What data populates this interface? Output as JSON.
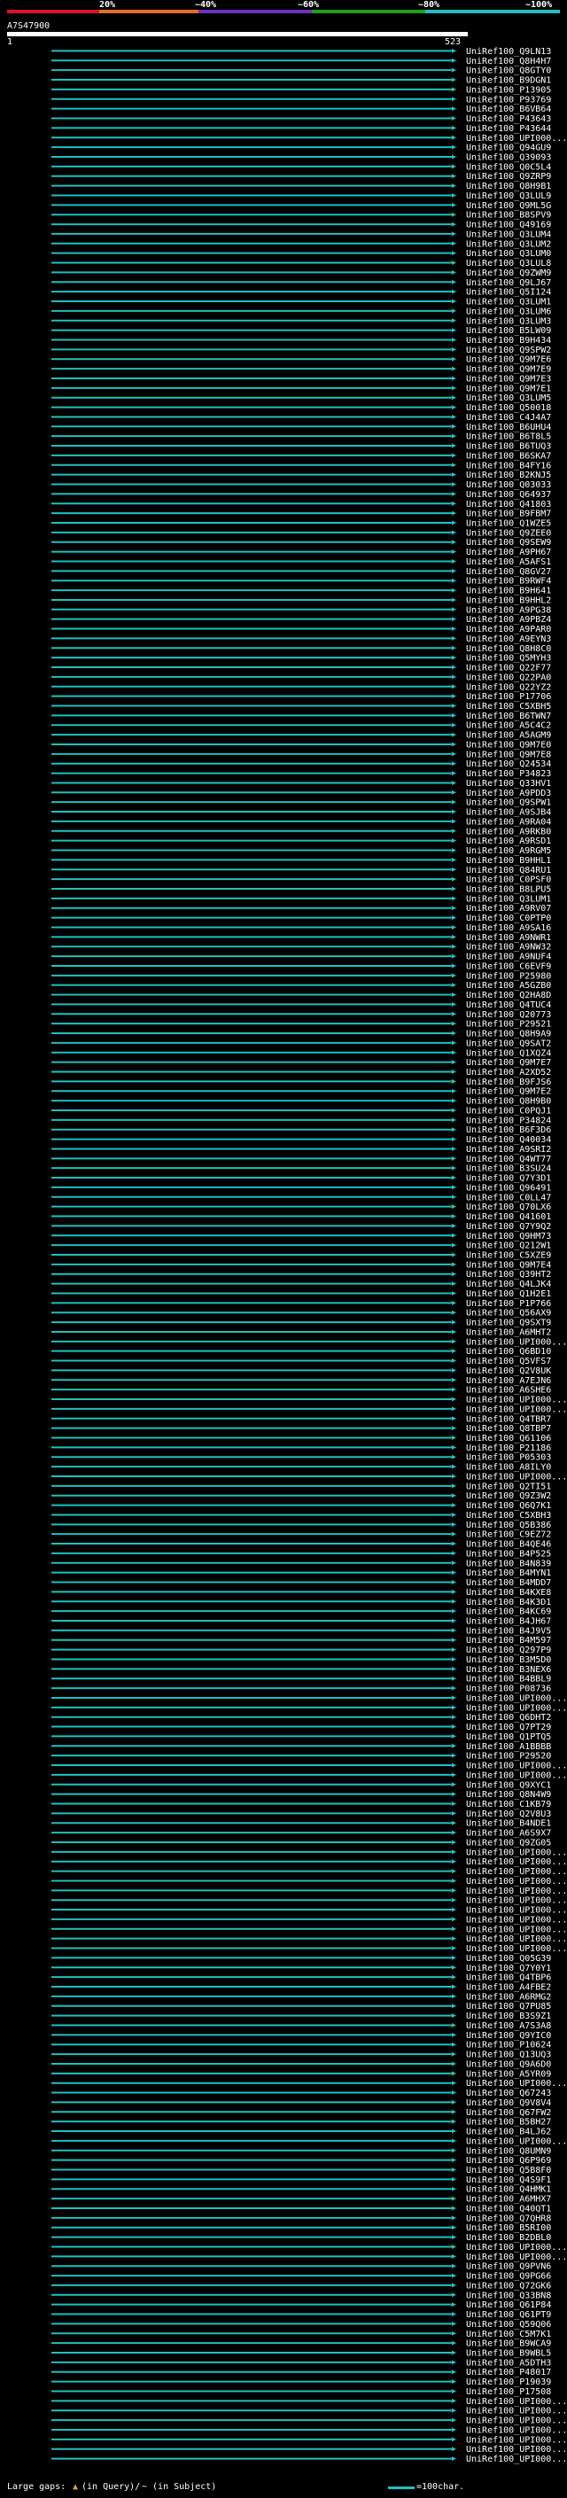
{
  "header": {
    "tick_labels": [
      "20%",
      "~40%",
      "~60%",
      "~80%",
      "~100%"
    ],
    "tick_colors": [
      "#e0102a",
      "#e07020",
      "#7030c0",
      "#20a020",
      "#20c0c0"
    ]
  },
  "query": {
    "name": "A7S47900",
    "start": "1",
    "end": "523"
  },
  "colors": {
    "hit": "#20c0c0",
    "query_bar": "#ffffff",
    "background": "#000000"
  },
  "hits": [
    {
      "name": "UniRef100_Q9LN13"
    },
    {
      "name": "UniRef100_Q8H4H7"
    },
    {
      "name": "UniRef100_Q8GTY0"
    },
    {
      "name": "UniRef100_B9DGN1"
    },
    {
      "name": "UniRef100_P13905"
    },
    {
      "name": "UniRef100_P93769"
    },
    {
      "name": "UniRef100_B6VB64"
    },
    {
      "name": "UniRef100_P43643"
    },
    {
      "name": "UniRef100_P43644"
    },
    {
      "name": "UniRef100_UPI000..."
    },
    {
      "name": "UniRef100_Q94GU9"
    },
    {
      "name": "UniRef100_Q39093"
    },
    {
      "name": "UniRef100_Q0C5L4"
    },
    {
      "name": "UniRef100_Q9ZRP9"
    },
    {
      "name": "UniRef100_Q8H9B1"
    },
    {
      "name": "UniRef100_Q3LUL9"
    },
    {
      "name": "UniRef100_Q9ML5G"
    },
    {
      "name": "UniRef100_B8SPV9"
    },
    {
      "name": "UniRef100_Q49169"
    },
    {
      "name": "UniRef100_Q3LUM4"
    },
    {
      "name": "UniRef100_Q3LUM2"
    },
    {
      "name": "UniRef100_Q3LUM0"
    },
    {
      "name": "UniRef100_Q3LUL8"
    },
    {
      "name": "UniRef100_Q9ZWM9"
    },
    {
      "name": "UniRef100_Q9LJ67"
    },
    {
      "name": "UniRef100_Q5I124"
    },
    {
      "name": "UniRef100_Q3LUM1"
    },
    {
      "name": "UniRef100_Q3LUM6"
    },
    {
      "name": "UniRef100_Q3LUM3"
    },
    {
      "name": "UniRef100_B5LW09"
    },
    {
      "name": "UniRef100_B9H434"
    },
    {
      "name": "UniRef100_Q9SPW2"
    },
    {
      "name": "UniRef100_Q9M7E6"
    },
    {
      "name": "UniRef100_Q9M7E9"
    },
    {
      "name": "UniRef100_Q9M7E3"
    },
    {
      "name": "UniRef100_Q9M7E1"
    },
    {
      "name": "UniRef100_Q3LUM5"
    },
    {
      "name": "UniRef100_Q50018"
    },
    {
      "name": "UniRef100_C4J4A7"
    },
    {
      "name": "UniRef100_B6UHU4"
    },
    {
      "name": "UniRef100_B6T8L5"
    },
    {
      "name": "UniRef100_B6TUQ3"
    },
    {
      "name": "UniRef100_B6SKA7"
    },
    {
      "name": "UniRef100_B4FY16"
    },
    {
      "name": "UniRef100_B2KNJ5"
    },
    {
      "name": "UniRef100_Q03033"
    },
    {
      "name": "UniRef100_Q64937"
    },
    {
      "name": "UniRef100_Q41803"
    },
    {
      "name": "UniRef100_B9FBM7"
    },
    {
      "name": "UniRef100_Q1WZE5"
    },
    {
      "name": "UniRef100_Q9ZEE0"
    },
    {
      "name": "UniRef100_Q9SEW9"
    },
    {
      "name": "UniRef100_A9PH67"
    },
    {
      "name": "UniRef100_A5AFS1"
    },
    {
      "name": "UniRef100_Q8GV27"
    },
    {
      "name": "UniRef100_B9RWF4"
    },
    {
      "name": "UniRef100_B9H641"
    },
    {
      "name": "UniRef100_B9HHL2"
    },
    {
      "name": "UniRef100_A9PG38"
    },
    {
      "name": "UniRef100_A9PBZ4"
    },
    {
      "name": "UniRef100_A9PAR0"
    },
    {
      "name": "UniRef100_A9EYN3"
    },
    {
      "name": "UniRef100_Q8H8C0"
    },
    {
      "name": "UniRef100_Q5MYH3"
    },
    {
      "name": "UniRef100_Q22F77"
    },
    {
      "name": "UniRef100_Q22PA0"
    },
    {
      "name": "UniRef100_Q22YZ2"
    },
    {
      "name": "UniRef100_P17706"
    },
    {
      "name": "UniRef100_C5XBH5"
    },
    {
      "name": "UniRef100_B6TWN7"
    },
    {
      "name": "UniRef100_A5C4C2"
    },
    {
      "name": "UniRef100_A5AGM9"
    },
    {
      "name": "UniRef100_Q9M7E0"
    },
    {
      "name": "UniRef100_Q9M7E8"
    },
    {
      "name": "UniRef100_Q24534"
    },
    {
      "name": "UniRef100_P34823"
    },
    {
      "name": "UniRef100_Q33HV1"
    },
    {
      "name": "UniRef100_A9PDD3"
    },
    {
      "name": "UniRef100_Q9SPW1"
    },
    {
      "name": "UniRef100_A9SJB4"
    },
    {
      "name": "UniRef100_A9RA04"
    },
    {
      "name": "UniRef100_A9RKB0"
    },
    {
      "name": "UniRef100_A9RSD1"
    },
    {
      "name": "UniRef100_A9RGM5"
    },
    {
      "name": "UniRef100_B9HHL1"
    },
    {
      "name": "UniRef100_Q84RU1"
    },
    {
      "name": "UniRef100_C0PSF0"
    },
    {
      "name": "UniRef100_B8LPU5"
    },
    {
      "name": "UniRef100_Q3LUM1"
    },
    {
      "name": "UniRef100_A9RV07"
    },
    {
      "name": "UniRef100_C0PTP0"
    },
    {
      "name": "UniRef100_A9SA16"
    },
    {
      "name": "UniRef100_A9NWR1"
    },
    {
      "name": "UniRef100_A9NW32"
    },
    {
      "name": "UniRef100_A9NUF4"
    },
    {
      "name": "UniRef100_C6EVF9"
    },
    {
      "name": "UniRef100_P25980"
    },
    {
      "name": "UniRef100_A5GZB0"
    },
    {
      "name": "UniRef100_Q2HA8D"
    },
    {
      "name": "UniRef100_Q4TUC4"
    },
    {
      "name": "UniRef100_Q20773"
    },
    {
      "name": "UniRef100_P29521"
    },
    {
      "name": "UniRef100_Q8H9A9"
    },
    {
      "name": "UniRef100_Q9SAT2"
    },
    {
      "name": "UniRef100_Q1XQZ4"
    },
    {
      "name": "UniRef100_Q9M7E7"
    },
    {
      "name": "UniRef100_A2XD52"
    },
    {
      "name": "UniRef100_B9FJS6"
    },
    {
      "name": "UniRef100_Q9M7E2"
    },
    {
      "name": "UniRef100_Q8H9B0"
    },
    {
      "name": "UniRef100_C0PQJ1"
    },
    {
      "name": "UniRef100_P34824"
    },
    {
      "name": "UniRef100_B6F3D6"
    },
    {
      "name": "UniRef100_Q40034"
    },
    {
      "name": "UniRef100_A9SRI2"
    },
    {
      "name": "UniRef100_Q4WT77"
    },
    {
      "name": "UniRef100_B3SU24"
    },
    {
      "name": "UniRef100_Q7Y3D1"
    },
    {
      "name": "UniRef100_Q96491"
    },
    {
      "name": "UniRef100_C0LL47"
    },
    {
      "name": "UniRef100_Q70LX6"
    },
    {
      "name": "UniRef100_Q41601"
    },
    {
      "name": "UniRef100_Q7Y9Q2"
    },
    {
      "name": "UniRef100_Q9HM73"
    },
    {
      "name": "UniRef100_Q212W1"
    },
    {
      "name": "UniRef100_C5XZE9"
    },
    {
      "name": "UniRef100_Q9M7E4"
    },
    {
      "name": "UniRef100_Q39HT2"
    },
    {
      "name": "UniRef100_Q4LJK4"
    },
    {
      "name": "UniRef100_Q1H2E1"
    },
    {
      "name": "UniRef100_P1P766"
    },
    {
      "name": "UniRef100_Q56AX9"
    },
    {
      "name": "UniRef100_Q9SXT9"
    },
    {
      "name": "UniRef100_A6MHT2"
    },
    {
      "name": "UniRef100_UPI000..."
    },
    {
      "name": "UniRef100_Q6BD10"
    },
    {
      "name": "UniRef100_Q5VFS7"
    },
    {
      "name": "UniRef100_Q2V8UK"
    },
    {
      "name": "UniRef100_A7EJN6"
    },
    {
      "name": "UniRef100_A6SHE6"
    },
    {
      "name": "UniRef100_UPI000..."
    },
    {
      "name": "UniRef100_UPI000..."
    },
    {
      "name": "UniRef100_Q4TBR7"
    },
    {
      "name": "UniRef100_Q8TBP7"
    },
    {
      "name": "UniRef100_Q61106"
    },
    {
      "name": "UniRef100_P21186"
    },
    {
      "name": "UniRef100_P05303"
    },
    {
      "name": "UniRef100_A8ILY0"
    },
    {
      "name": "UniRef100_UPI000..."
    },
    {
      "name": "UniRef100_Q2TI51"
    },
    {
      "name": "UniRef100_Q9Z3W2"
    },
    {
      "name": "UniRef100_Q6Q7K1"
    },
    {
      "name": "UniRef100_C5XBH3"
    },
    {
      "name": "UniRef100_Q5B386"
    },
    {
      "name": "UniRef100_C9EZ72"
    },
    {
      "name": "UniRef100_B4QE46"
    },
    {
      "name": "UniRef100_B4P525"
    },
    {
      "name": "UniRef100_B4N839"
    },
    {
      "name": "UniRef100_B4MYN1"
    },
    {
      "name": "UniRef100_B4MDD7"
    },
    {
      "name": "UniRef100_B4KXE8"
    },
    {
      "name": "UniRef100_B4K3D1"
    },
    {
      "name": "UniRef100_B4KC69"
    },
    {
      "name": "UniRef100_B4JH67"
    },
    {
      "name": "UniRef100_B4J9V5"
    },
    {
      "name": "UniRef100_B4M597"
    },
    {
      "name": "UniRef100_Q297P9"
    },
    {
      "name": "UniRef100_B3M5D0"
    },
    {
      "name": "UniRef100_B3NEX6"
    },
    {
      "name": "UniRef100_B4BBL9"
    },
    {
      "name": "UniRef100_P08736"
    },
    {
      "name": "UniRef100_UPI000..."
    },
    {
      "name": "UniRef100_UPI000..."
    },
    {
      "name": "UniRef100_Q6DHT2"
    },
    {
      "name": "UniRef100_Q7PT29"
    },
    {
      "name": "UniRef100_Q1PTQ5"
    },
    {
      "name": "UniRef100_A1BBBB"
    },
    {
      "name": "UniRef100_P29520"
    },
    {
      "name": "UniRef100_UPI000..."
    },
    {
      "name": "UniRef100_UPI000..."
    },
    {
      "name": "UniRef100_Q9XYC1"
    },
    {
      "name": "UniRef100_Q8N4W9"
    },
    {
      "name": "UniRef100_C1KB79"
    },
    {
      "name": "UniRef100_Q2V8U3"
    },
    {
      "name": "UniRef100_B4NDE1"
    },
    {
      "name": "UniRef100_A6S9X7"
    },
    {
      "name": "UniRef100_Q9ZG05"
    },
    {
      "name": "UniRef100_UPI000..."
    },
    {
      "name": "UniRef100_UPI000..."
    },
    {
      "name": "UniRef100_UPI000..."
    },
    {
      "name": "UniRef100_UPI000..."
    },
    {
      "name": "UniRef100_UPI000..."
    },
    {
      "name": "UniRef100_UPI000..."
    },
    {
      "name": "UniRef100_UPI000..."
    },
    {
      "name": "UniRef100_UPI000..."
    },
    {
      "name": "UniRef100_UPI000..."
    },
    {
      "name": "UniRef100_UPI000..."
    },
    {
      "name": "UniRef100_UPI000..."
    },
    {
      "name": "UniRef100_Q05G39"
    },
    {
      "name": "UniRef100_Q7Y0Y1"
    },
    {
      "name": "UniRef100_Q4TBP6"
    },
    {
      "name": "UniRef100_A4FBE2"
    },
    {
      "name": "UniRef100_A6RMG2"
    },
    {
      "name": "UniRef100_Q7PU85"
    },
    {
      "name": "UniRef100_B3S9Z1"
    },
    {
      "name": "UniRef100_A7S3A8"
    },
    {
      "name": "UniRef100_Q9YIC0"
    },
    {
      "name": "UniRef100_P10624"
    },
    {
      "name": "UniRef100_Q13UQ3"
    },
    {
      "name": "UniRef100_Q9A6D0"
    },
    {
      "name": "UniRef100_A5YR09"
    },
    {
      "name": "UniRef100_UPI000..."
    },
    {
      "name": "UniRef100_Q67243"
    },
    {
      "name": "UniRef100_Q9V8V4"
    },
    {
      "name": "UniRef100_Q67FW2"
    },
    {
      "name": "UniRef100_B5BH27"
    },
    {
      "name": "UniRef100_B4LJ62"
    },
    {
      "name": "UniRef100_UPI000..."
    },
    {
      "name": "UniRef100_Q8UMN9"
    },
    {
      "name": "UniRef100_Q6P969"
    },
    {
      "name": "UniRef100_Q5B8F0"
    },
    {
      "name": "UniRef100_Q4S9F1"
    },
    {
      "name": "UniRef100_Q4HMK1"
    },
    {
      "name": "UniRef100_A6MHX7"
    },
    {
      "name": "UniRef100_Q40QT1"
    },
    {
      "name": "UniRef100_Q7QHR8"
    },
    {
      "name": "UniRef100_B5RI00"
    },
    {
      "name": "UniRef100_B2DBL0"
    },
    {
      "name": "UniRef100_UPI000..."
    },
    {
      "name": "UniRef100_UPI000..."
    },
    {
      "name": "UniRef100_Q9PVN6"
    },
    {
      "name": "UniRef100_Q9PG66"
    },
    {
      "name": "UniRef100_Q72GK6"
    },
    {
      "name": "UniRef100_Q33BN8"
    },
    {
      "name": "UniRef100_Q61P84"
    },
    {
      "name": "UniRef100_Q61PT9"
    },
    {
      "name": "UniRef100_Q59Q06"
    },
    {
      "name": "UniRef100_C5M7K1"
    },
    {
      "name": "UniRef100_B9WCA9"
    },
    {
      "name": "UniRef100_B9WBL5"
    },
    {
      "name": "UniRef100_A5DTH3"
    },
    {
      "name": "UniRef100_P48017"
    },
    {
      "name": "UniRef100_P19039"
    },
    {
      "name": "UniRef100_P17508"
    },
    {
      "name": "UniRef100_UPI000..."
    },
    {
      "name": "UniRef100_UPI000..."
    },
    {
      "name": "UniRef100_UPI000..."
    },
    {
      "name": "UniRef100_UPI000..."
    },
    {
      "name": "UniRef100_UPI000..."
    },
    {
      "name": "UniRef100_UPI000..."
    },
    {
      "name": "UniRef100_UPI000..."
    }
  ],
  "legend": {
    "large_gaps": "Large gaps:",
    "in_query": "(in Query)/",
    "in_subject": "~ (in Subject)",
    "scale": "=100char."
  }
}
